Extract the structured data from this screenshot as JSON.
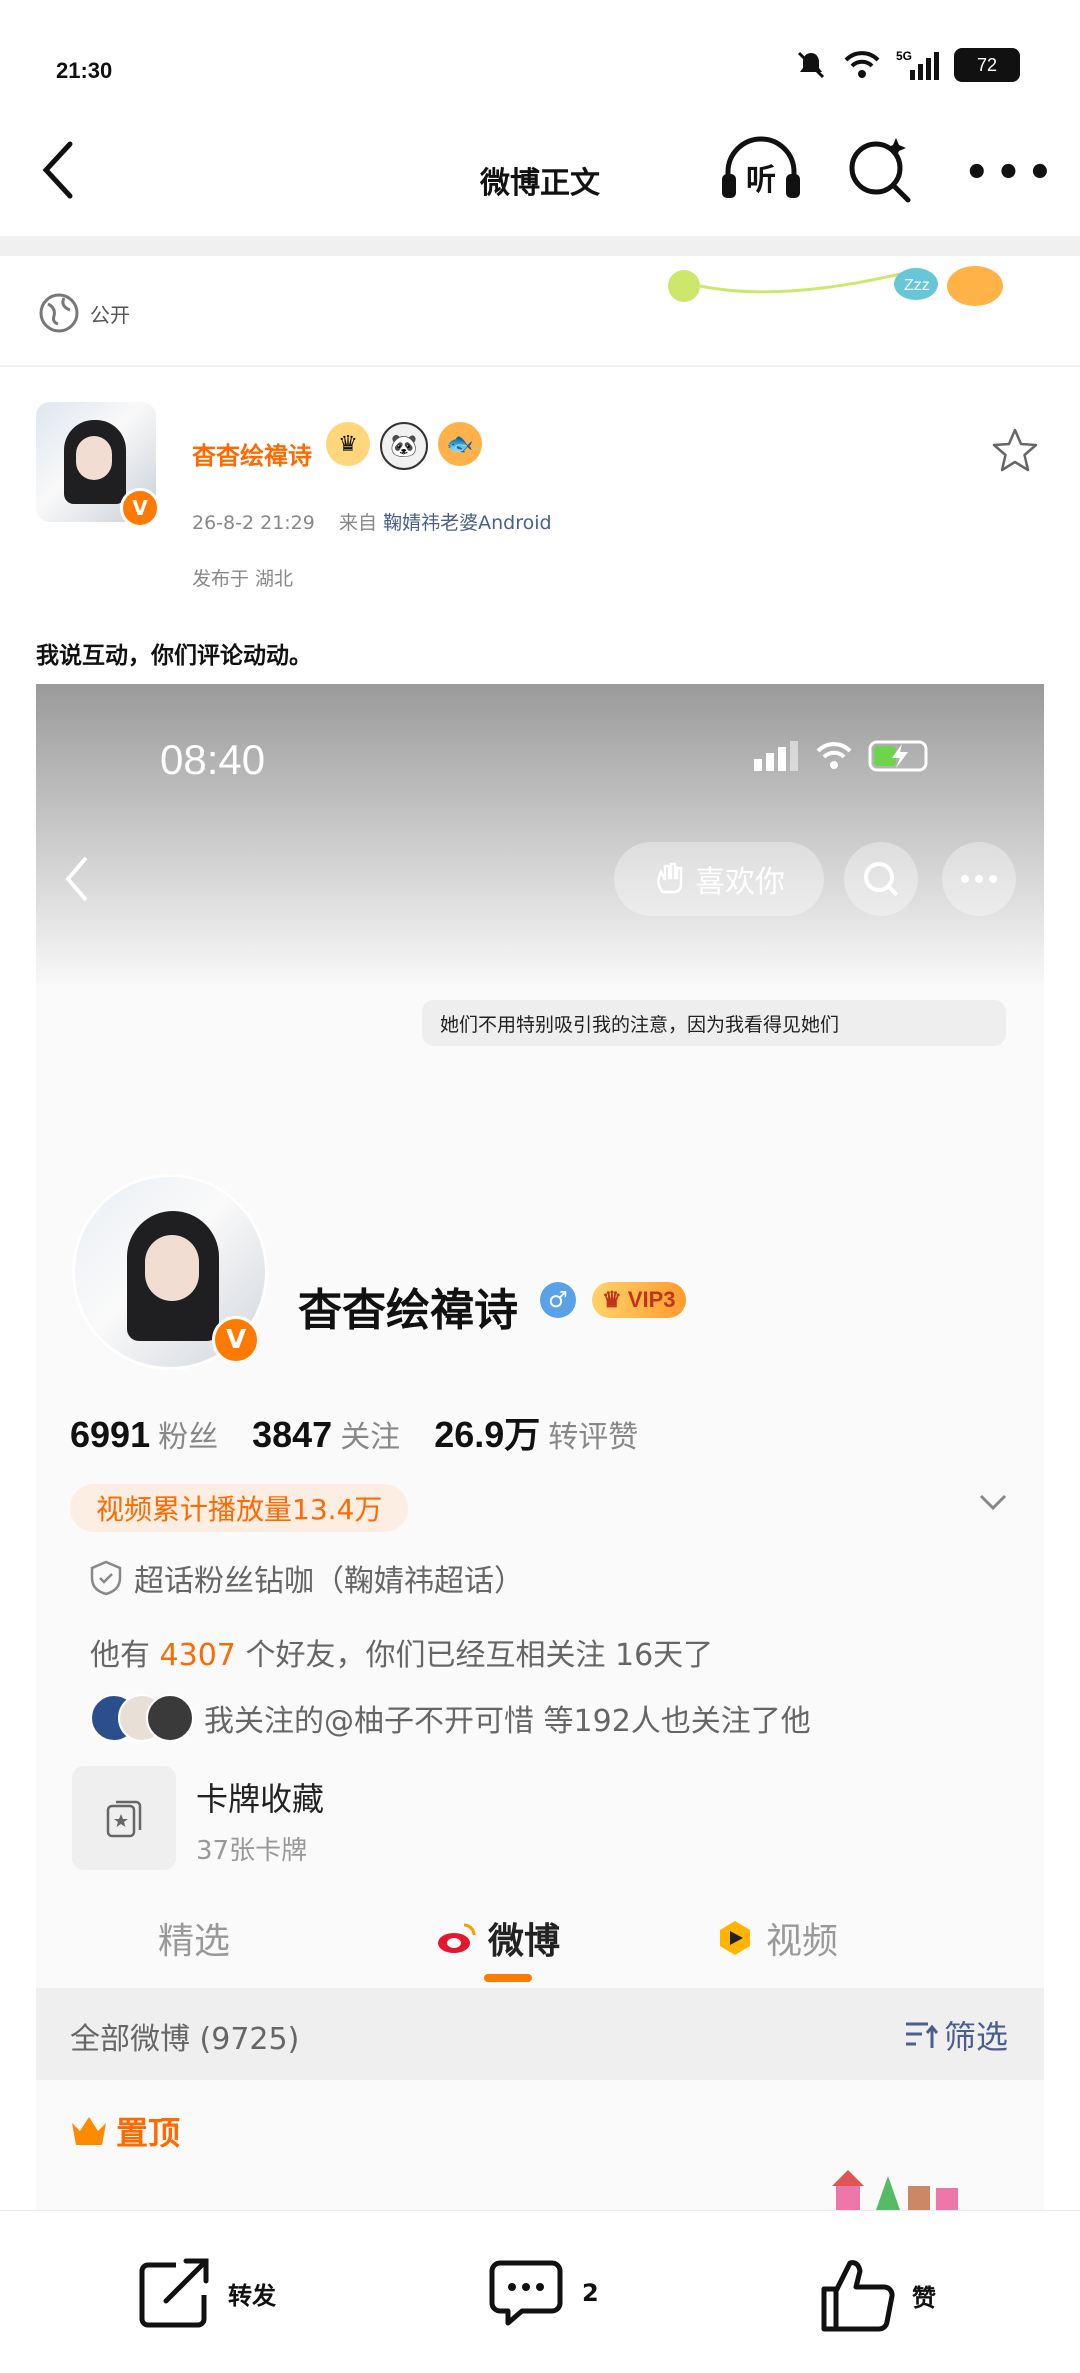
{
  "status_bar": {
    "time": "21:30",
    "battery": "72",
    "network": "5G"
  },
  "nav": {
    "title": "微博正文",
    "listen_label": "听"
  },
  "visibility": {
    "label": "公开"
  },
  "post": {
    "username": "杳杳绘禕诗",
    "verified_badge": "V",
    "timestamp": "26-8-2 21:29",
    "from_prefix": "来自",
    "source": "鞠婧祎老婆Android",
    "location": "发布于 湖北",
    "text": "我说互动，你们评论动动。"
  },
  "screenshot": {
    "time": "08:40",
    "like_button": "喜欢你",
    "bio": "她们不用特别吸引我的注意，因为我看得见她们",
    "profile_name": "杳杳绘禕诗",
    "vip_label": "VIP3",
    "stats": [
      {
        "num": "6991",
        "label": "粉丝"
      },
      {
        "num": "3847",
        "label": "关注"
      },
      {
        "num": "26.9万",
        "label": "转评赞"
      }
    ],
    "play_count": "视频累计播放量13.4万",
    "chaohua": "超话粉丝钻咖（鞠婧祎超话）",
    "friends_prefix": "他有",
    "friends_count": "4307",
    "friends_suffix": "个好友，你们已经互相关注 16天了",
    "mutual": "我关注的@柚子不开可惜 等192人也关注了他",
    "card_title": "卡牌收藏",
    "card_sub": "37张卡牌",
    "tabs": [
      "精选",
      "微博",
      "视频"
    ],
    "all_weibo": "全部微博 (9725)",
    "filter": "筛选",
    "pinned": "置顶"
  },
  "bottom_bar": {
    "repost": "转发",
    "comment_count": "2",
    "like": "赞"
  },
  "colors": {
    "accent": "#ff6a00",
    "link": "#4b5f8c"
  }
}
